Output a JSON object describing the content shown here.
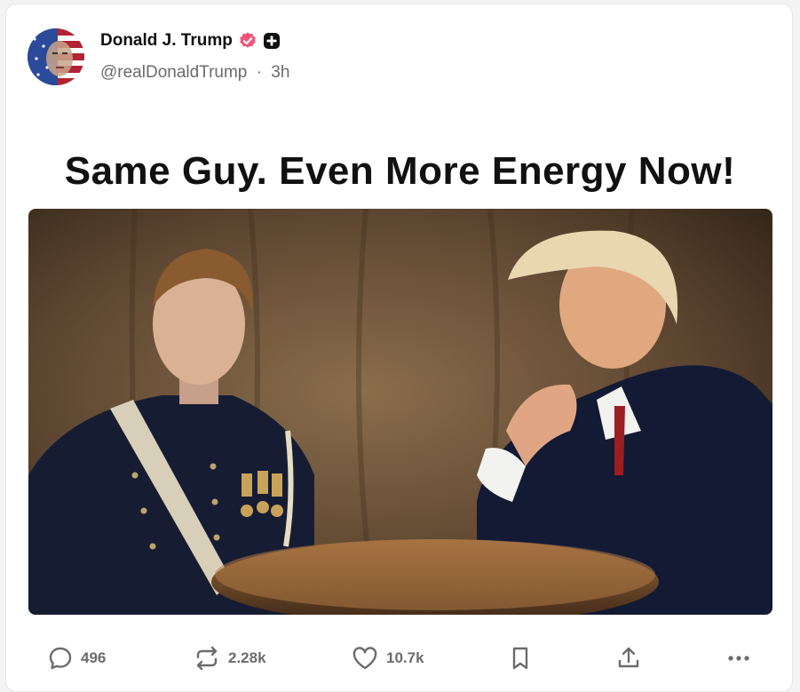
{
  "post": {
    "author_name": "Donald J. Trump",
    "handle": "@realDonaldTrump",
    "separator": "·",
    "time": "3h",
    "headline": "Same Guy. Even More Energy Now!",
    "media_alt": "Photo: young cadet in dark uniform and older man in suit seated at a round table"
  },
  "actions": {
    "replies": "496",
    "reposts": "2.28k",
    "likes": "10.7k"
  },
  "icons": {
    "verified": "verified-badge-icon",
    "plus": "plus-badge-icon",
    "reply": "reply-bubble-icon",
    "repost": "repost-arrows-icon",
    "like": "heart-icon",
    "bookmark": "bookmark-icon",
    "share": "share-upload-icon",
    "more": "more-dots-icon"
  },
  "colors": {
    "verified": "#f0567a",
    "text_primary": "#111111",
    "text_secondary": "#6b6b6b"
  }
}
